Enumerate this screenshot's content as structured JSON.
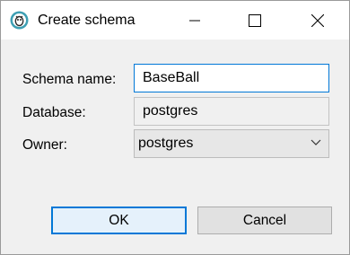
{
  "window": {
    "title": "Create schema",
    "app_icon": "app-logo-icon",
    "controls": [
      "minimize-icon",
      "maximize-icon",
      "close-icon"
    ]
  },
  "form": {
    "schema_name_label": "Schema name:",
    "schema_name_value": "BaseBall",
    "database_label": "Database:",
    "database_value": "postgres",
    "owner_label": "Owner:",
    "owner_value": "postgres"
  },
  "buttons": {
    "ok_label": "OK",
    "cancel_label": "Cancel"
  },
  "colors": {
    "accent": "#0078d7",
    "dialog_bg": "#f0f0f0",
    "titlebar_bg": "#ffffff"
  }
}
